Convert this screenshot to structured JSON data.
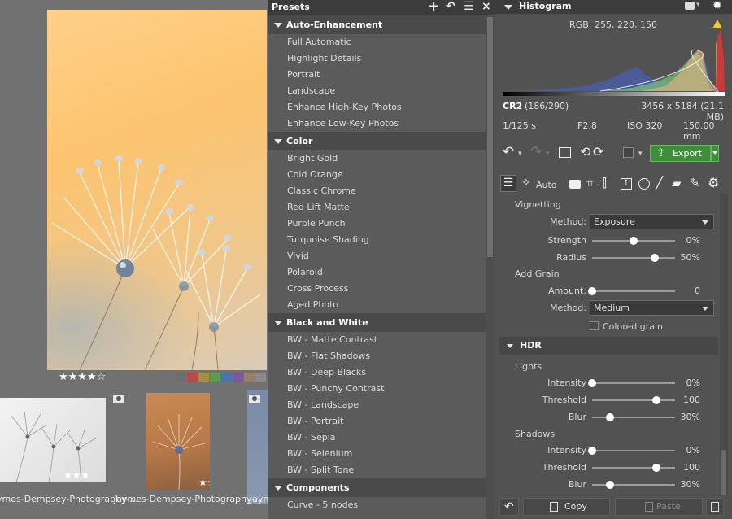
{
  "viewer": {
    "main_rating": "★★★★☆",
    "color_labels": [
      "#6e6e6e",
      "#b84a4a",
      "#a39044",
      "#5e9a4f",
      "#4b74a8",
      "#7a5a9a",
      "#9a7f6a",
      "#8a8a8a"
    ],
    "thumbnails": [
      {
        "filename": "ymes-Dempsey-Photography-...",
        "rating": "★★★"
      },
      {
        "filename": "Jaymes-Dempsey-Photography-...",
        "rating": "★★★★"
      },
      {
        "filename": "Jaym"
      }
    ]
  },
  "presets": {
    "title": "Presets",
    "categories": [
      {
        "name": "Auto-Enhancement",
        "items": [
          "Full Automatic",
          "Highlight Details",
          "Portrait",
          "Landscape",
          "Enhance High-Key Photos",
          "Enhance Low-Key Photos"
        ]
      },
      {
        "name": "Color",
        "items": [
          "Bright Gold",
          "Cold Orange",
          "Classic Chrome",
          "Red Lift Matte",
          "Purple Punch",
          "Turquoise Shading",
          "Vivid",
          "Polaroid",
          "Cross Process",
          "Aged Photo"
        ]
      },
      {
        "name": "Black and White",
        "items": [
          "BW - Matte Contrast",
          "BW - Flat Shadows",
          "BW - Deep Blacks",
          "BW - Punchy Contrast",
          "BW - Landscape",
          "BW - Portrait",
          "BW - Sepia",
          "BW - Selenium",
          "BW - Split Tone"
        ]
      },
      {
        "name": "Components",
        "items": [
          "Curve - 5 nodes"
        ]
      }
    ]
  },
  "histogram": {
    "title": "Histogram",
    "rgb": "RGB: 255, 220, 150",
    "format": "CR2",
    "index": "(186/290)",
    "dimensions": "3456 x 5184 (21.1 MB)",
    "shutter": "1/125 s",
    "aperture": "F2.8",
    "iso": "ISO 320",
    "focal": "150.00 mm"
  },
  "toolbar": {
    "export_label": "Export",
    "auto_label": "Auto"
  },
  "vignetting": {
    "title": "Vignetting",
    "method_label": "Method:",
    "method_value": "Exposure",
    "strength_label": "Strength",
    "strength_value": "0%",
    "strength_pos": 0.5,
    "radius_label": "Radius",
    "radius_value": "50%",
    "radius_pos": 0.75
  },
  "grain": {
    "title": "Add Grain",
    "amount_label": "Amount:",
    "amount_value": "0",
    "amount_pos": 0,
    "method_label": "Method:",
    "method_value": "Medium",
    "colored_label": "Colored grain"
  },
  "hdr": {
    "title": "HDR",
    "lights": {
      "title": "Lights",
      "intensity_label": "Intensity",
      "intensity_value": "0%",
      "intensity_pos": 0,
      "threshold_label": "Threshold",
      "threshold_value": "100",
      "threshold_pos": 0.77,
      "blur_label": "Blur",
      "blur_value": "30%",
      "blur_pos": 0.22
    },
    "shadows": {
      "title": "Shadows",
      "intensity_label": "Intensity",
      "intensity_value": "0%",
      "intensity_pos": 0,
      "threshold_label": "Threshold",
      "threshold_value": "100",
      "threshold_pos": 0.77,
      "blur_label": "Blur",
      "blur_value": "30%",
      "blur_pos": 0.22
    }
  },
  "bottom": {
    "copy_label": "Copy",
    "paste_label": "Paste"
  }
}
